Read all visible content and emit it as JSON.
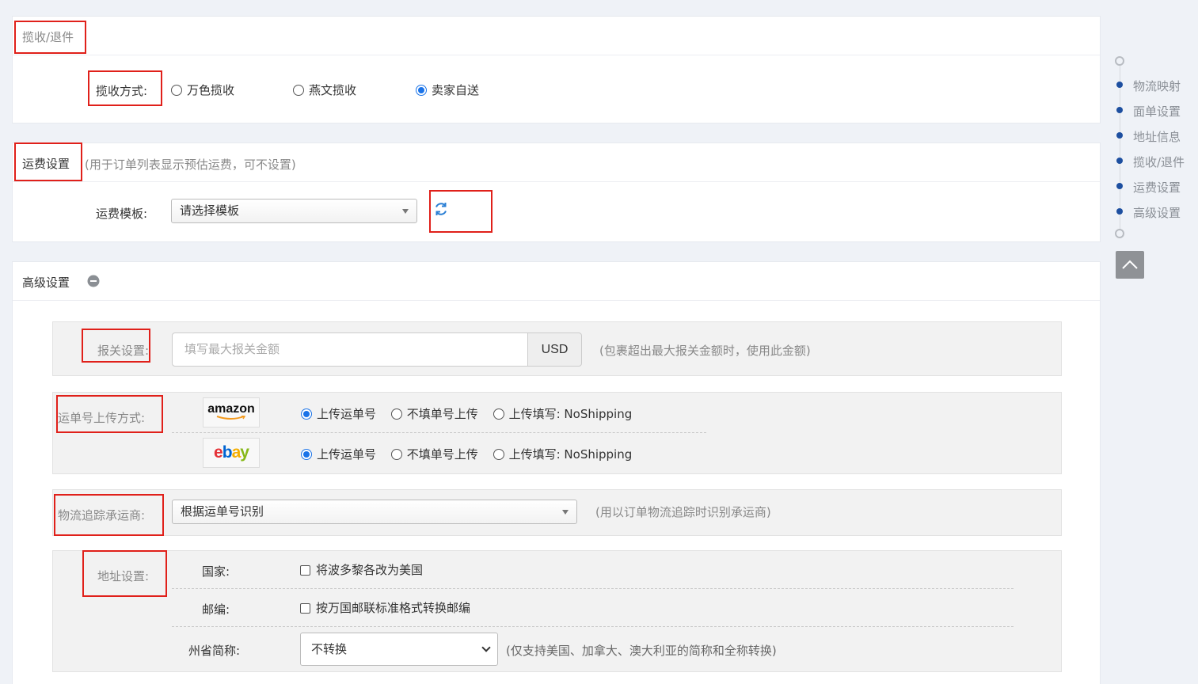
{
  "section_pickup": {
    "title": "揽收/退件",
    "method_label": "揽收方式:",
    "options": [
      "万色揽收",
      "燕文揽收",
      "卖家自送"
    ],
    "selected_index": 2
  },
  "section_shipping": {
    "title": "运费设置",
    "subtitle": "(用于订单列表显示预估运费，可不设置)",
    "template_label": "运费模板:",
    "template_value": "请选择模板",
    "refresh_icon": "refresh-icon"
  },
  "section_advanced": {
    "title": "高级设置",
    "collapse_icon": "minus-circle-icon",
    "customs": {
      "label": "报关设置:",
      "placeholder": "填写最大报关金额",
      "currency": "USD",
      "hint": "(包裹超出最大报关金额时，使用此金额)"
    },
    "tracking_upload": {
      "label": "运单号上传方式:",
      "platforms": [
        {
          "logo": "amazon",
          "selected_index": 0
        },
        {
          "logo": "ebay",
          "selected_index": 0
        }
      ],
      "options": [
        "上传运单号",
        "不填单号上传",
        "上传填写: NoShipping"
      ]
    },
    "carrier": {
      "label": "物流追踪承运商:",
      "value": "根据运单号识别",
      "hint": "(用以订单物流追踪时识别承运商)"
    },
    "address": {
      "label": "地址设置:",
      "country_label": "国家:",
      "country_option": "将波多黎各改为美国",
      "zip_label": "邮编:",
      "zip_option": "按万国邮联标准格式转换邮编",
      "state_label": "州省简称:",
      "state_value": "不转换",
      "state_hint": "(仅支持美国、加拿大、澳大利亚的简称和全称转换)"
    }
  },
  "side_nav": {
    "items": [
      "物流映射",
      "面单设置",
      "地址信息",
      "揽收/退件",
      "运费设置",
      "高级设置"
    ],
    "back_to_top_icon": "chevron-up-icon"
  },
  "colors": {
    "accent": "#1a73e8",
    "nav_dot": "#1d4fa0",
    "highlight_box": "#e0201a"
  }
}
